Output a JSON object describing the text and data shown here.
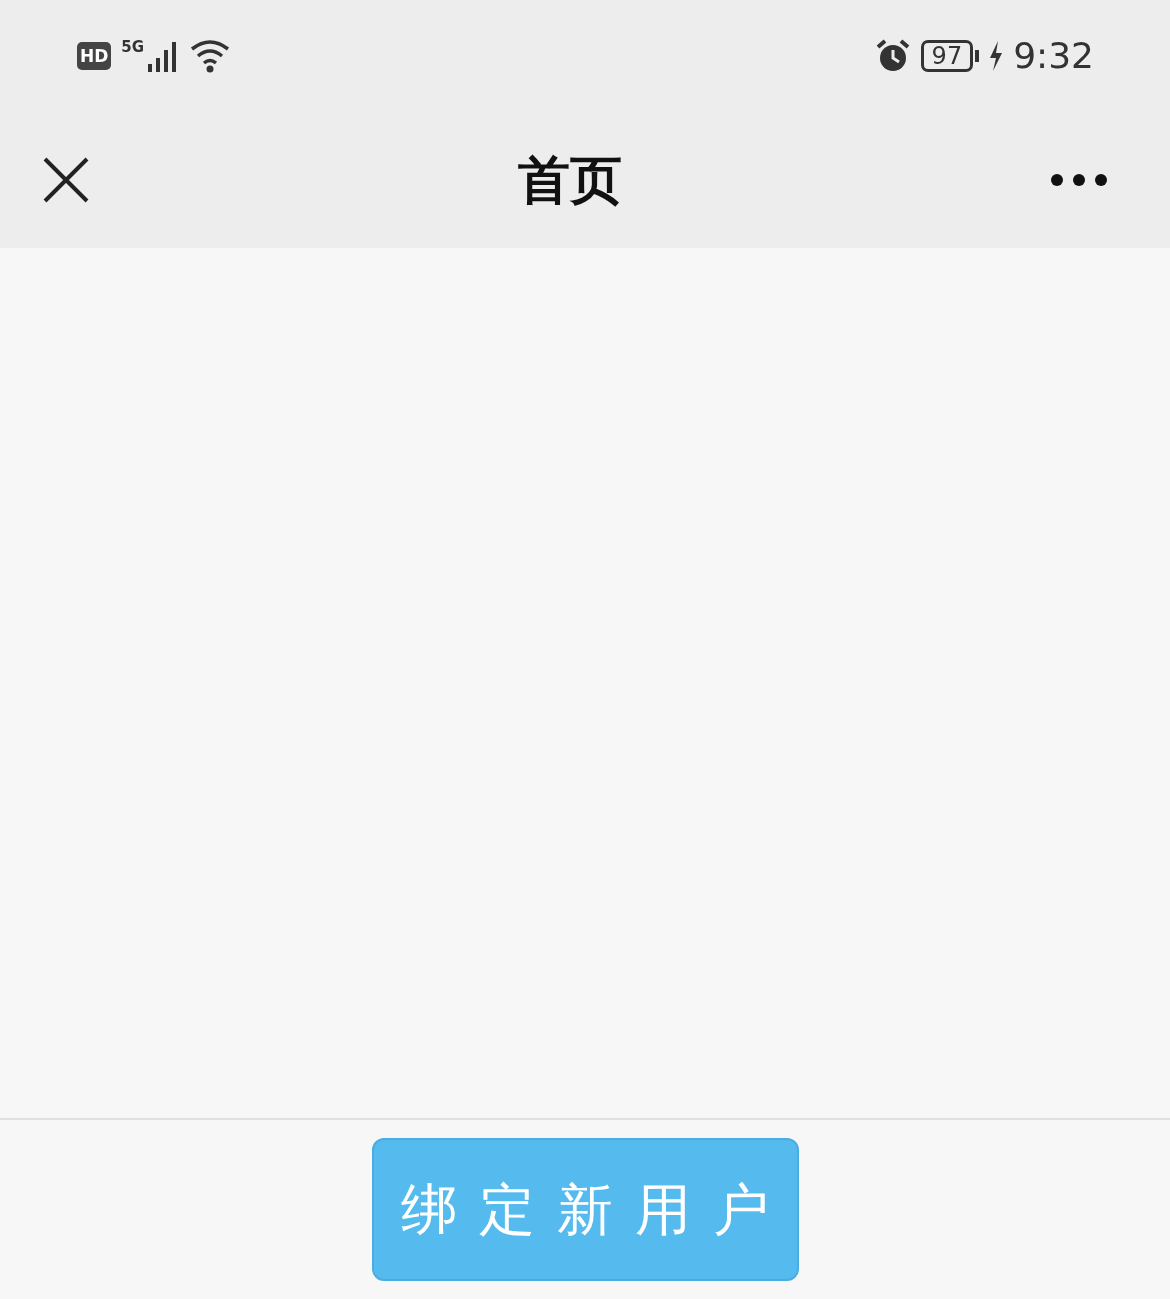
{
  "status_bar": {
    "hd_badge": "HD",
    "network": "5G",
    "battery": "97",
    "time": "9:32"
  },
  "nav_bar": {
    "title": "首页"
  },
  "footer": {
    "button": "绑定新用户"
  }
}
